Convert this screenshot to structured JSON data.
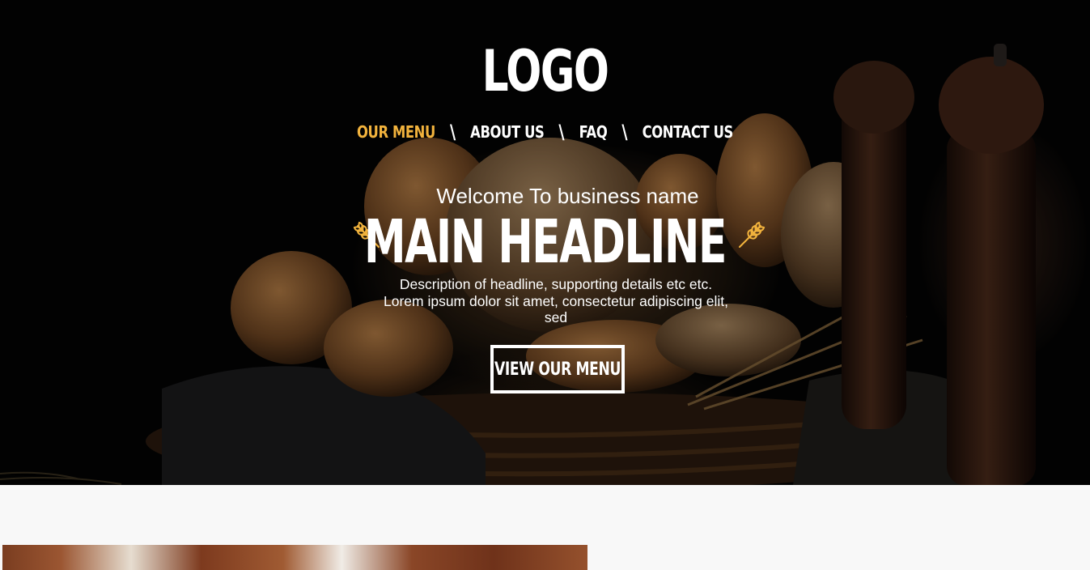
{
  "header": {
    "logo": "LOGO",
    "nav": [
      {
        "label": "OUR MENU",
        "active": true
      },
      {
        "label": "ABOUT US",
        "active": false
      },
      {
        "label": "FAQ",
        "active": false
      },
      {
        "label": "CONTACT US",
        "active": false
      }
    ],
    "nav_separator": "\\"
  },
  "hero": {
    "welcome": "Welcome To business name",
    "headline": "MAIN HEADLINE",
    "description": "Description of headline, supporting details etc etc. Lorem ipsum dolor sit amet, consectetur adipiscing elit, sed",
    "cta_label": "VIEW OUR MENU",
    "decoration_icon": "wheat-icon"
  },
  "colors": {
    "accent": "#f2b33d",
    "text": "#ffffff",
    "hero_background": "#040404",
    "page_background": "#f8f8f8"
  }
}
